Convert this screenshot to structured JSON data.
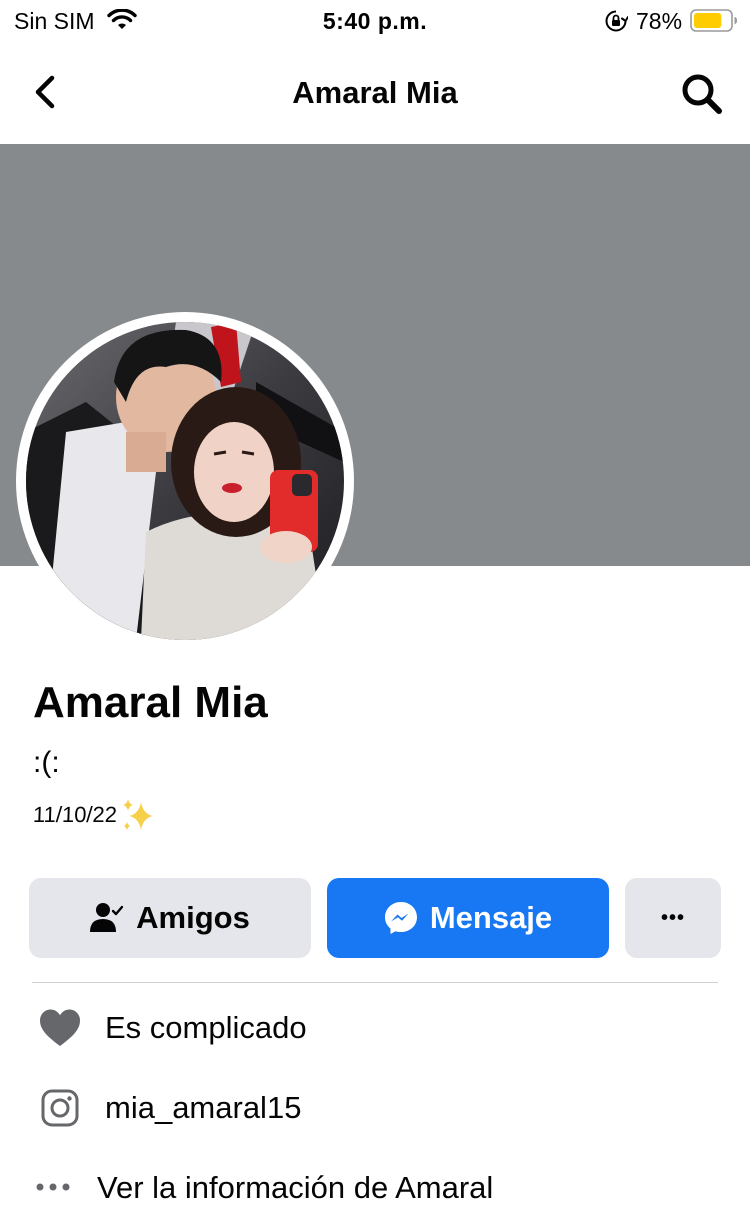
{
  "status_bar": {
    "carrier": "Sin SIM",
    "time": "5:40 p.m.",
    "battery_percent": "78%",
    "battery_level": 0.78,
    "battery_color": "#ffcc00"
  },
  "nav": {
    "title": "Amaral Mia",
    "back_icon": "chevron-left-icon",
    "search_icon": "search-icon"
  },
  "profile": {
    "name": "Amaral Mia",
    "bio_line1": ":(:",
    "bio_date": "11/10/22",
    "bio_emoji": "sparkles-icon"
  },
  "actions": {
    "friends_label": "Amigos",
    "message_label": "Mensaje",
    "more_label": "•••"
  },
  "details": {
    "relationship": "Es complicado",
    "instagram": "mia_amaral15",
    "about": "Ver la información de Amaral"
  },
  "colors": {
    "cover": "#868a8d",
    "primary": "#1877f2",
    "button_gray": "#e4e6eb",
    "icon_gray": "#65676b"
  }
}
